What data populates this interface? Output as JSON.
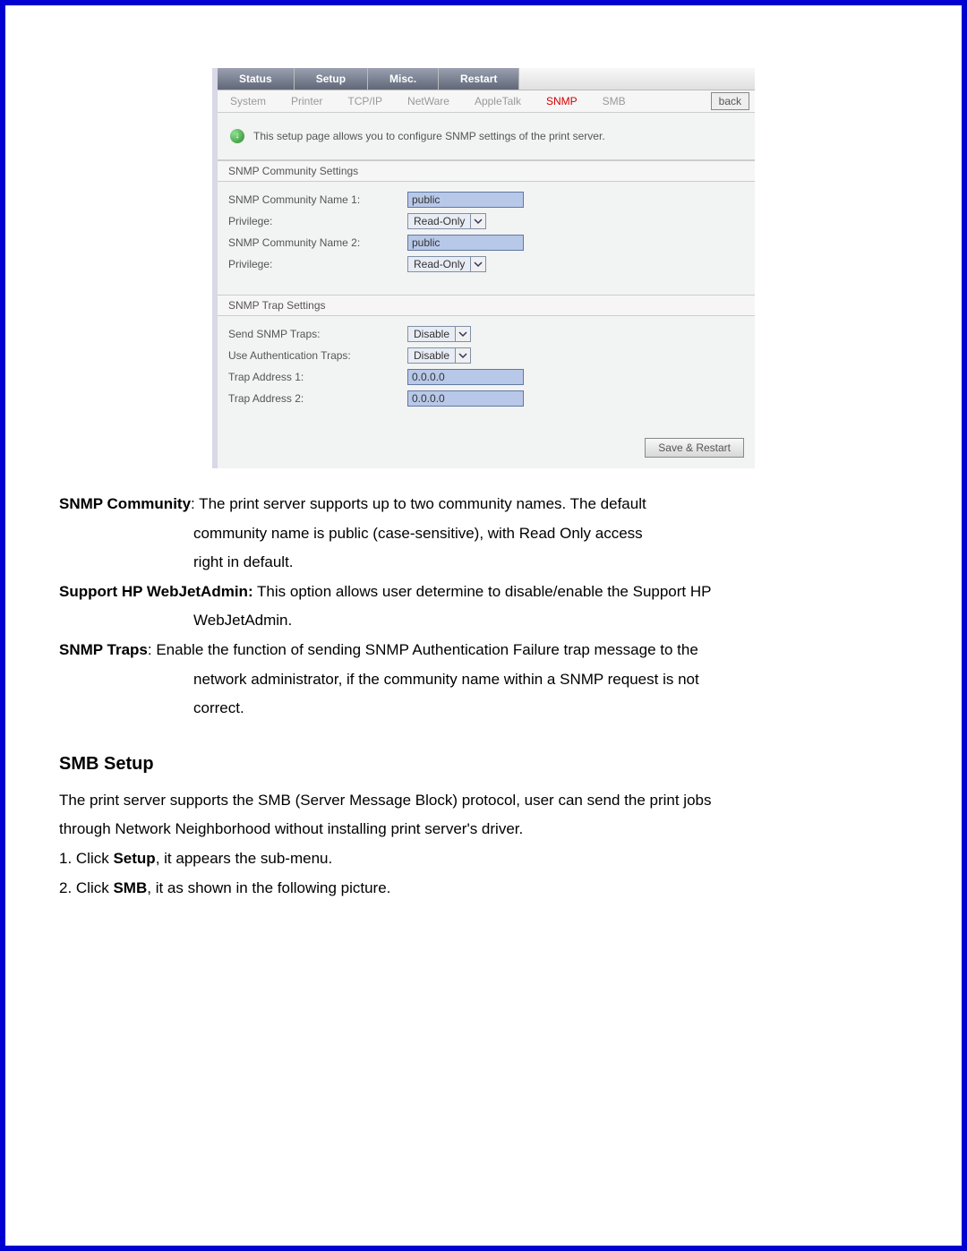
{
  "screenshot": {
    "main_tabs": [
      "Status",
      "Setup",
      "Misc.",
      "Restart"
    ],
    "sub_tabs": {
      "items": [
        "System",
        "Printer",
        "TCP/IP",
        "NetWare",
        "AppleTalk",
        "SNMP",
        "SMB"
      ],
      "active": "SNMP",
      "back": "back"
    },
    "info_text": "This setup page allows you to configure SNMP settings of the print server.",
    "section1": {
      "title": "SNMP Community Settings",
      "rows": {
        "name1_label": "SNMP Community Name 1:",
        "name1_value": "public",
        "priv1_label": "Privilege:",
        "priv1_value": "Read-Only",
        "name2_label": "SNMP Community Name 2:",
        "name2_value": "public",
        "priv2_label": "Privilege:",
        "priv2_value": "Read-Only"
      }
    },
    "section2": {
      "title": "SNMP Trap Settings",
      "rows": {
        "send_label": "Send SNMP Traps:",
        "send_value": "Disable",
        "auth_label": "Use Authentication Traps:",
        "auth_value": "Disable",
        "addr1_label": "Trap Address 1:",
        "addr1_value": "0.0.0.0",
        "addr2_label": "Trap Address 2:",
        "addr2_value": "0.0.0.0"
      }
    },
    "save_button": "Save & Restart"
  },
  "doc": {
    "snmp_community_bold": "SNMP Community",
    "snmp_community_text1": ": The print server supports up to two community names. The default",
    "snmp_community_text2": "community name is public (case-sensitive), with Read Only access",
    "snmp_community_text3": "right in default.",
    "hp_bold": "Support HP WebJetAdmin:",
    "hp_text1": " This option allows user determine to disable/enable the Support HP",
    "hp_text2": "WebJetAdmin.",
    "traps_bold": "SNMP Traps",
    "traps_text1": ": Enable the function of sending SNMP Authentication Failure trap message to the",
    "traps_text2": "network administrator, if the community name within a SNMP request is not",
    "traps_text3": "correct.",
    "smb_heading": "SMB Setup",
    "smb_p1": "The print server supports the SMB (Server Message Block) protocol, user can send the print jobs",
    "smb_p2": "through Network Neighborhood without installing print server's driver.",
    "step1a": "1. Click ",
    "step1b": "Setup",
    "step1c": ", it appears the sub-menu.",
    "step2a": "2. Click ",
    "step2b": "SMB",
    "step2c": ", it as shown in the following picture."
  }
}
